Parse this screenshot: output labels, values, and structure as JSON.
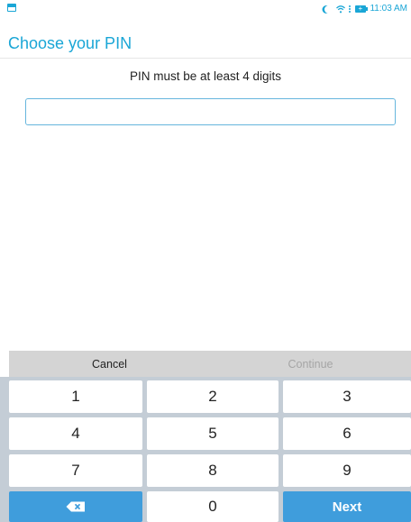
{
  "status_bar": {
    "time": "11:03 AM",
    "icons": [
      "notification-icon",
      "moon-icon",
      "wifi-icon",
      "battery-charging-icon"
    ]
  },
  "header": {
    "title": "Choose your PIN"
  },
  "main": {
    "hint": "PIN must be at least 4 digits",
    "pin_value": ""
  },
  "actions": {
    "cancel_label": "Cancel",
    "continue_label": "Continue"
  },
  "keypad": {
    "digits": [
      "1",
      "2",
      "3",
      "4",
      "5",
      "6",
      "7",
      "8",
      "9",
      "0"
    ],
    "next_label": "Next",
    "backspace_icon": "backspace-icon"
  },
  "colors": {
    "accent": "#1aa6d6",
    "field_border": "#66b6dd",
    "keypad_bg": "#c4cdd6",
    "key_blue": "#3f9ddc",
    "action_bar_bg": "#d4d4d4",
    "disabled_text": "#a5a5a5"
  }
}
